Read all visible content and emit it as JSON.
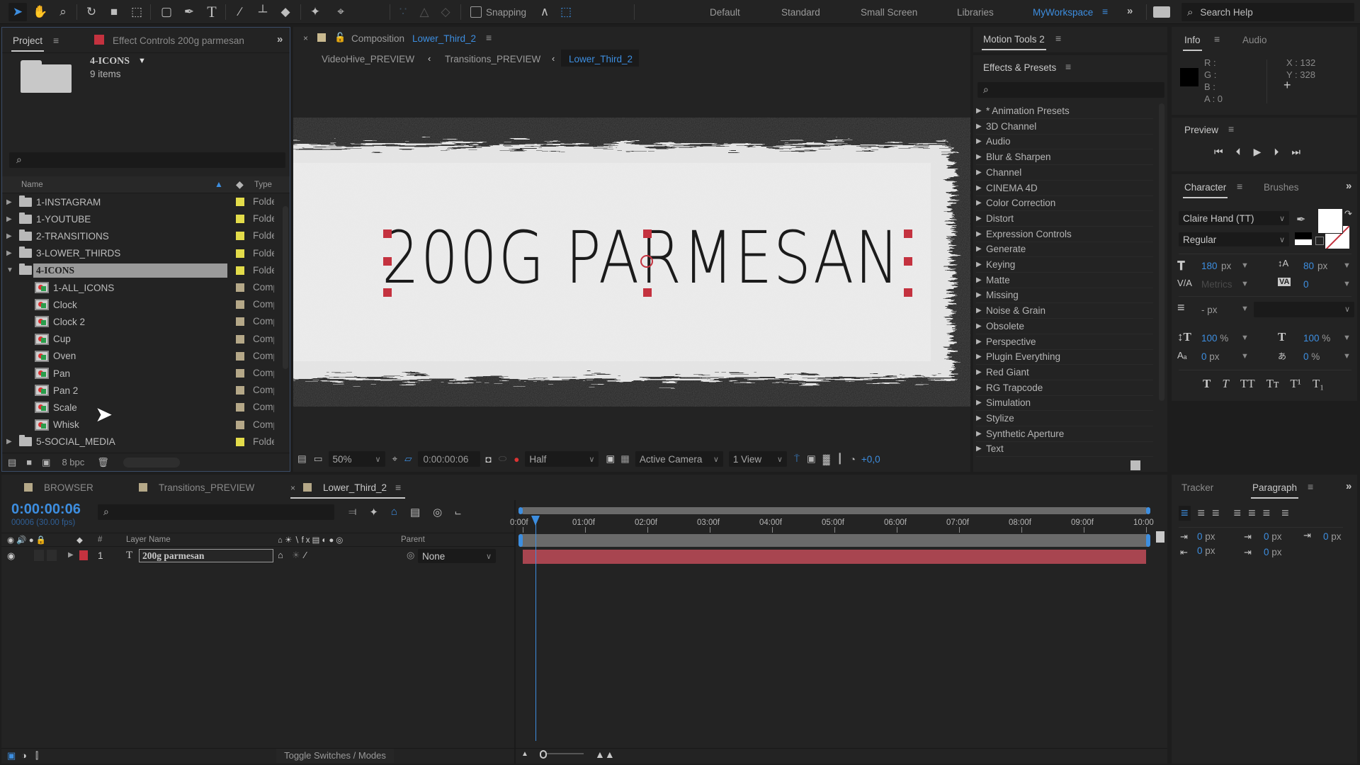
{
  "toolbar": {
    "tools": [
      "selection-tool",
      "hand-tool",
      "zoom-tool",
      "rotate-tool",
      "camera-tool",
      "pan-behind-tool",
      "rectangle-tool",
      "pen-tool",
      "type-tool",
      "brush-tool",
      "clone-stamp-tool",
      "eraser-tool",
      "roto-brush-tool",
      "puppet-pin-tool"
    ],
    "snapping_label": "Snapping",
    "workspaces": [
      "Default",
      "Standard",
      "Small Screen",
      "Libraries",
      "MyWorkspace"
    ],
    "active_workspace": "MyWorkspace",
    "search_placeholder": "Search Help"
  },
  "project": {
    "tab_label": "Project",
    "effect_controls_label": "Effect Controls 200g parmesan",
    "selected_name": "4-ICONS",
    "selected_count": "9 items",
    "search_placeholder": "",
    "col_name": "Name",
    "col_type": "Type",
    "items": [
      {
        "name": "1-INSTAGRAM",
        "kind": "folder",
        "expanded": false,
        "type": "Folder",
        "label_color": "#e3dc4a"
      },
      {
        "name": "1-YOUTUBE",
        "kind": "folder",
        "expanded": false,
        "type": "Folder",
        "label_color": "#e3dc4a"
      },
      {
        "name": "2-TRANSITIONS",
        "kind": "folder",
        "expanded": false,
        "type": "Folder",
        "label_color": "#e3dc4a"
      },
      {
        "name": "3-LOWER_THIRDS",
        "kind": "folder",
        "expanded": false,
        "type": "Folder",
        "label_color": "#e3dc4a"
      },
      {
        "name": "4-ICONS",
        "kind": "folder",
        "expanded": true,
        "selected": true,
        "type": "Folder",
        "label_color": "#e3dc4a"
      },
      {
        "name": "1-ALL_ICONS",
        "kind": "comp",
        "type": "Composition",
        "label_color": "#b5a888"
      },
      {
        "name": "Clock",
        "kind": "comp",
        "type": "Composition",
        "label_color": "#b5a888"
      },
      {
        "name": "Clock 2",
        "kind": "comp",
        "type": "Composition",
        "label_color": "#b5a888"
      },
      {
        "name": "Cup",
        "kind": "comp",
        "type": "Composition",
        "label_color": "#b5a888"
      },
      {
        "name": "Oven",
        "kind": "comp",
        "type": "Composition",
        "label_color": "#b5a888"
      },
      {
        "name": "Pan",
        "kind": "comp",
        "type": "Composition",
        "label_color": "#b5a888"
      },
      {
        "name": "Pan 2",
        "kind": "comp",
        "type": "Composition",
        "label_color": "#b5a888"
      },
      {
        "name": "Scale",
        "kind": "comp",
        "type": "Composition",
        "label_color": "#b5a888"
      },
      {
        "name": "Whisk",
        "kind": "comp",
        "type": "Composition",
        "label_color": "#b5a888"
      },
      {
        "name": "5-SOCIAL_MEDIA",
        "kind": "folder",
        "expanded": false,
        "type": "Folder",
        "label_color": "#e3dc4a"
      }
    ],
    "bpc_label": "8 bpc"
  },
  "composition": {
    "tab_prefix": "Composition",
    "tab_name": "Lower_Third_2",
    "breadcrumbs": [
      "VideoHive_PREVIEW",
      "Transitions_PREVIEW",
      "Lower_Third_2"
    ],
    "canvas_text": "200G PARMESAN",
    "zoom": "50%",
    "timecode": "0:00:00:06",
    "resolution": "Half",
    "camera": "Active Camera",
    "views": "1 View",
    "exposure": "+0,0"
  },
  "motion_tools": {
    "title": "Motion Tools 2"
  },
  "effects": {
    "title": "Effects & Presets",
    "search_placeholder": "",
    "categories": [
      "* Animation Presets",
      "3D Channel",
      "Audio",
      "Blur & Sharpen",
      "Channel",
      "CINEMA 4D",
      "Color Correction",
      "Distort",
      "Expression Controls",
      "Generate",
      "Keying",
      "Matte",
      "Missing",
      "Noise & Grain",
      "Obsolete",
      "Perspective",
      "Plugin Everything",
      "Red Giant",
      "RG Trapcode",
      "Simulation",
      "Stylize",
      "Synthetic Aperture",
      "Text"
    ]
  },
  "info": {
    "tab_label": "Info",
    "audio_tab": "Audio",
    "r": "R :",
    "g": "G :",
    "b": "B :",
    "a": "A : 0",
    "x": "X : 132",
    "y": "Y : 328"
  },
  "preview": {
    "title": "Preview"
  },
  "character": {
    "tab_label": "Character",
    "brushes_tab": "Brushes",
    "font": "Claire Hand (TT)",
    "style": "Regular",
    "font_size": "180",
    "font_size_unit": "px",
    "leading": "80",
    "leading_unit": "px",
    "kerning": "Metrics",
    "tracking": "0",
    "stroke_width": "-",
    "stroke_unit": "px",
    "vert_scale": "100",
    "horiz_scale": "100",
    "baseline": "0",
    "baseline_unit": "px",
    "tsume": "0",
    "fill_color": "#ffffff",
    "style_buttons": [
      "T",
      "T",
      "TT",
      "Tт",
      "T¹",
      "T₁"
    ]
  },
  "timeline": {
    "tabs": [
      {
        "label": "BROWSER",
        "color": "#b5a888"
      },
      {
        "label": "Transitions_PREVIEW",
        "color": "#b5a888"
      },
      {
        "label": "Lower_Third_2",
        "color": "#b5a888",
        "active": true
      }
    ],
    "timecode": "0:00:00:06",
    "frame_info": "00006 (30.00 fps)",
    "col_layer_name": "Layer Name",
    "col_num": "#",
    "col_parent": "Parent",
    "layers": [
      {
        "num": "1",
        "type": "T",
        "name": "200g parmesan",
        "label_color": "#c4323f",
        "parent": "None"
      }
    ],
    "ruler": [
      "0:00f",
      "01:00f",
      "02:00f",
      "03:00f",
      "04:00f",
      "05:00f",
      "06:00f",
      "07:00f",
      "08:00f",
      "09:00f",
      "10:00"
    ],
    "playhead_seconds": 0.2,
    "duration_seconds": 10,
    "toggle_label": "Toggle Switches / Modes"
  },
  "tracker": {
    "tab_label": "Tracker"
  },
  "paragraph": {
    "tab_label": "Paragraph",
    "indent_left": "0",
    "indent_right": "0",
    "indent_first": "0",
    "space_before": "0",
    "space_after": "0",
    "unit": "px"
  }
}
